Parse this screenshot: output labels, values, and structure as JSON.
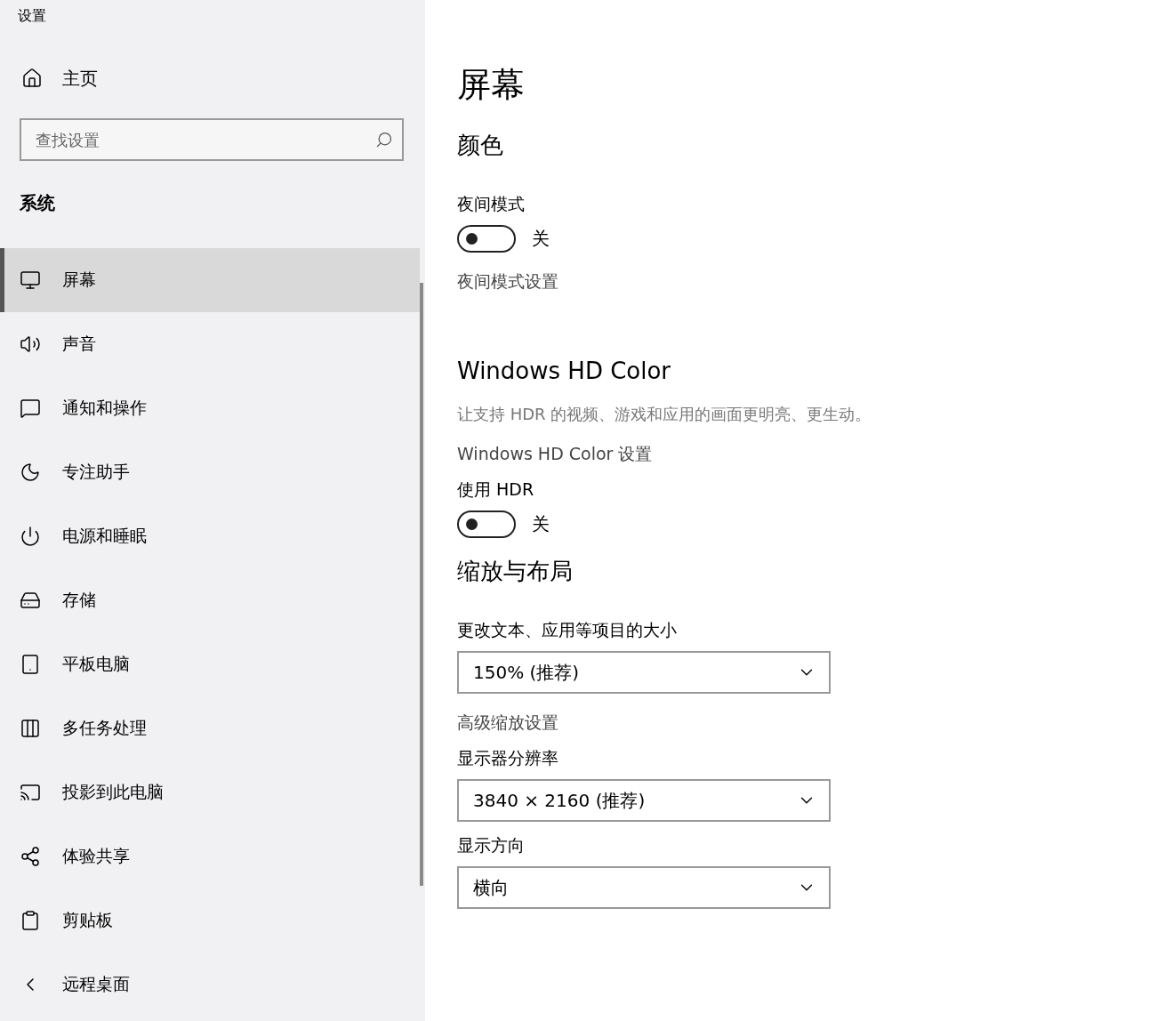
{
  "window": {
    "title": "设置"
  },
  "sidebar": {
    "home": "主页",
    "search": {
      "placeholder": "查找设置"
    },
    "group": "系统",
    "items": [
      {
        "label": "屏幕",
        "selected": true
      },
      {
        "label": "声音",
        "selected": false
      },
      {
        "label": "通知和操作",
        "selected": false
      },
      {
        "label": "专注助手",
        "selected": false
      },
      {
        "label": "电源和睡眠",
        "selected": false
      },
      {
        "label": "存储",
        "selected": false
      },
      {
        "label": "平板电脑",
        "selected": false
      },
      {
        "label": "多任务处理",
        "selected": false
      },
      {
        "label": "投影到此电脑",
        "selected": false
      },
      {
        "label": "体验共享",
        "selected": false
      },
      {
        "label": "剪贴板",
        "selected": false
      },
      {
        "label": "远程桌面",
        "selected": false
      }
    ]
  },
  "main": {
    "title": "屏幕",
    "blocks": [
      {
        "kind": "section",
        "text": "颜色"
      },
      {
        "kind": "label",
        "text": "夜间模式"
      },
      {
        "kind": "toggle",
        "on": false,
        "text": "关"
      },
      {
        "kind": "link",
        "text": "夜间模式设置"
      },
      {
        "kind": "section",
        "text": "Windows HD Color"
      },
      {
        "kind": "description",
        "text": "让支持 HDR 的视频、游戏和应用的画面更明亮、更生动。"
      },
      {
        "kind": "link",
        "text": "Windows HD Color 设置"
      },
      {
        "kind": "label",
        "text": "使用 HDR"
      },
      {
        "kind": "toggle",
        "on": false,
        "text": "关"
      },
      {
        "kind": "section",
        "text": "缩放与布局"
      },
      {
        "kind": "label",
        "text": "更改文本、应用等项目的大小"
      },
      {
        "kind": "dropdown",
        "text": "150% (推荐)"
      },
      {
        "kind": "link",
        "text": "高级缩放设置"
      },
      {
        "kind": "label",
        "text": "显示器分辨率"
      },
      {
        "kind": "dropdown",
        "text": "3840 × 2160 (推荐)"
      },
      {
        "kind": "label",
        "text": "显示方向"
      },
      {
        "kind": "dropdown",
        "text": "横向"
      }
    ]
  }
}
